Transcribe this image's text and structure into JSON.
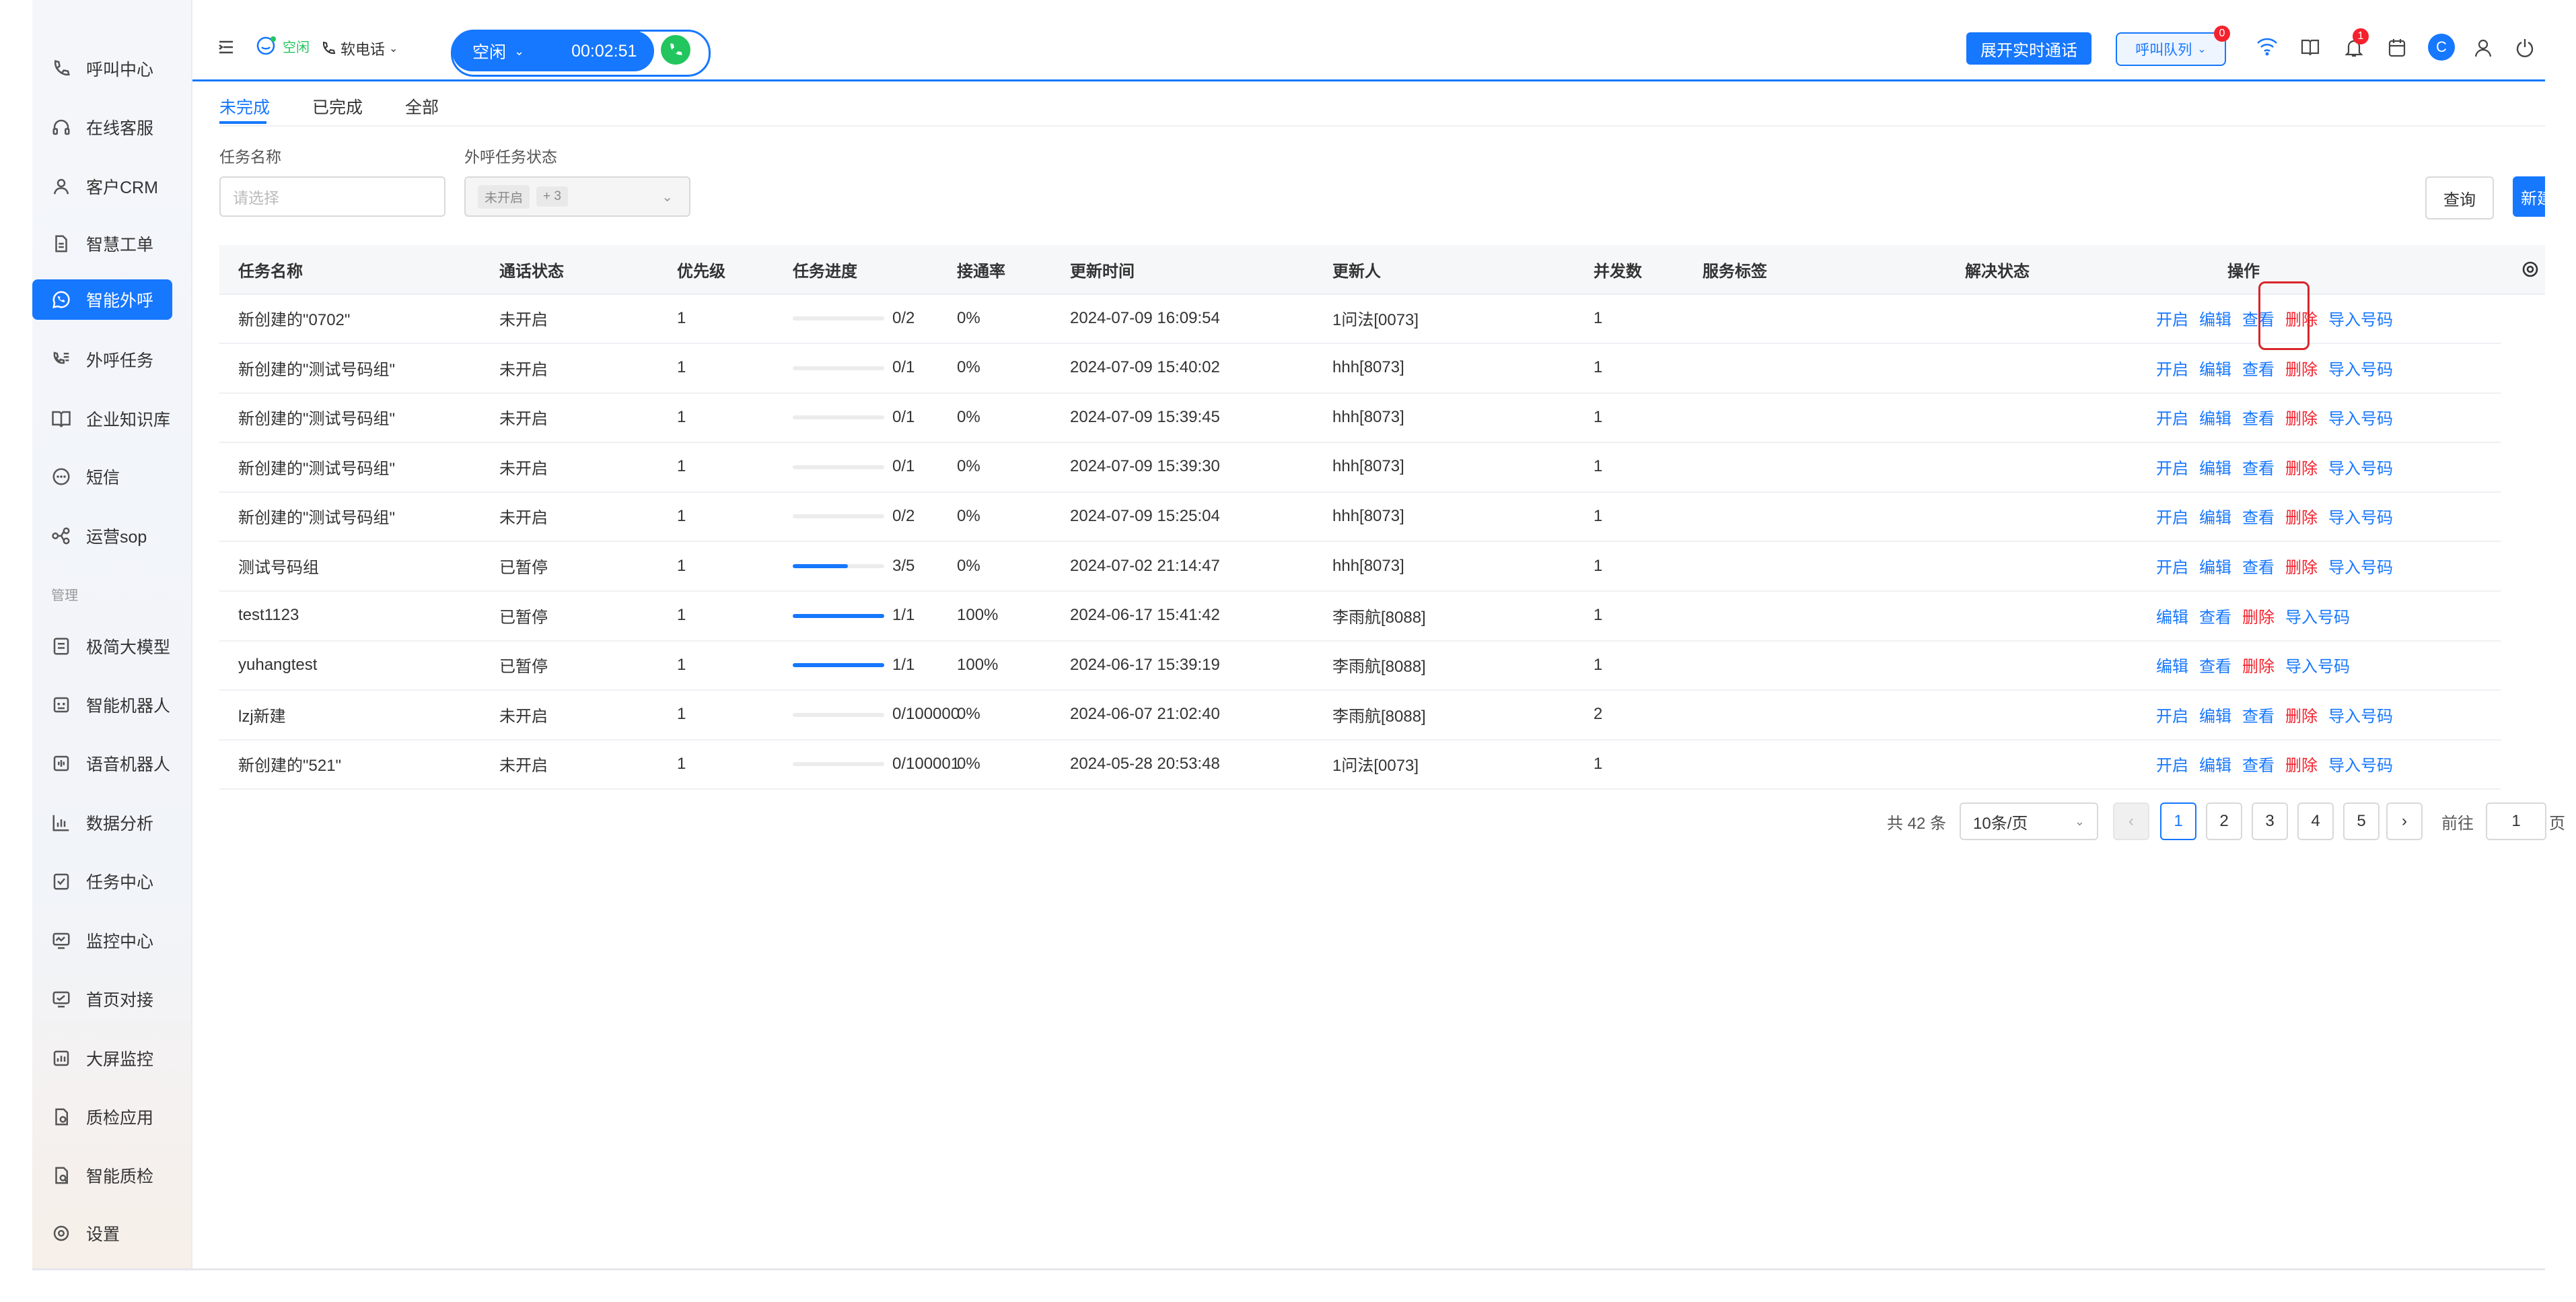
{
  "sidebar": {
    "items": [
      {
        "label": "呼叫中心",
        "icon": "phone-icon"
      },
      {
        "label": "在线客服",
        "icon": "headset-icon"
      },
      {
        "label": "客户CRM",
        "icon": "user-icon"
      },
      {
        "label": "智慧工单",
        "icon": "document-icon"
      },
      {
        "label": "智能外呼",
        "icon": "chat-phone-icon"
      },
      {
        "label": "外呼任务",
        "icon": "phone-list-icon"
      },
      {
        "label": "企业知识库",
        "icon": "book-icon"
      },
      {
        "label": "短信",
        "icon": "message-icon"
      },
      {
        "label": "运营sop",
        "icon": "flow-icon"
      }
    ],
    "section_label": "管理",
    "items2": [
      {
        "label": "极简大模型",
        "icon": "model-icon"
      },
      {
        "label": "智能机器人",
        "icon": "robot-icon"
      },
      {
        "label": "语音机器人",
        "icon": "voice-robot-icon"
      },
      {
        "label": "数据分析",
        "icon": "chart-icon"
      },
      {
        "label": "任务中心",
        "icon": "task-icon"
      },
      {
        "label": "监控中心",
        "icon": "monitor-icon"
      },
      {
        "label": "首页对接",
        "icon": "home-link-icon"
      },
      {
        "label": "大屏监控",
        "icon": "screen-icon"
      },
      {
        "label": "质检应用",
        "icon": "quality-icon"
      },
      {
        "label": "智能质检",
        "icon": "smart-quality-icon"
      },
      {
        "label": "设置",
        "icon": "settings-icon"
      }
    ]
  },
  "header": {
    "status_small": "空闲",
    "phone_mode": "软电话",
    "status": "空闲",
    "timer": "00:02:51",
    "expand_btn": "展开实时通话",
    "queue_btn": "呼叫队列",
    "queue_badge": "0",
    "bell_badge": "1",
    "avatar_letter": "C"
  },
  "tabs": [
    "未完成",
    "已完成",
    "全部"
  ],
  "filters": {
    "task_name_label": "任务名称",
    "task_name_placeholder": "请选择",
    "status_label": "外呼任务状态",
    "status_tag": "未开启",
    "status_more": "+ 3",
    "query_btn": "查询",
    "new_btn": "新建"
  },
  "table": {
    "headers": [
      "任务名称",
      "通话状态",
      "优先级",
      "任务进度",
      "接通率",
      "更新时间",
      "更新人",
      "并发数",
      "服务标签",
      "解决状态",
      "操作"
    ],
    "rows": [
      {
        "name": "新创建的\"0702\"",
        "call_status": "未开启",
        "priority": "1",
        "progress": "0/2",
        "progress_pct": 0,
        "rate": "0%",
        "time": "2024-07-09 16:09:54",
        "updater": "1问法[0073]",
        "concurrency": "1",
        "ops": [
          "开启",
          "编辑",
          "查看",
          "删除",
          "导入号码"
        ]
      },
      {
        "name": "新创建的\"测试号码组\"",
        "call_status": "未开启",
        "priority": "1",
        "progress": "0/1",
        "progress_pct": 0,
        "rate": "0%",
        "time": "2024-07-09 15:40:02",
        "updater": "hhh[8073]",
        "concurrency": "1",
        "ops": [
          "开启",
          "编辑",
          "查看",
          "删除",
          "导入号码"
        ]
      },
      {
        "name": "新创建的\"测试号码组\"",
        "call_status": "未开启",
        "priority": "1",
        "progress": "0/1",
        "progress_pct": 0,
        "rate": "0%",
        "time": "2024-07-09 15:39:45",
        "updater": "hhh[8073]",
        "concurrency": "1",
        "ops": [
          "开启",
          "编辑",
          "查看",
          "删除",
          "导入号码"
        ]
      },
      {
        "name": "新创建的\"测试号码组\"",
        "call_status": "未开启",
        "priority": "1",
        "progress": "0/1",
        "progress_pct": 0,
        "rate": "0%",
        "time": "2024-07-09 15:39:30",
        "updater": "hhh[8073]",
        "concurrency": "1",
        "ops": [
          "开启",
          "编辑",
          "查看",
          "删除",
          "导入号码"
        ]
      },
      {
        "name": "新创建的\"测试号码组\"",
        "call_status": "未开启",
        "priority": "1",
        "progress": "0/2",
        "progress_pct": 0,
        "rate": "0%",
        "time": "2024-07-09 15:25:04",
        "updater": "hhh[8073]",
        "concurrency": "1",
        "ops": [
          "开启",
          "编辑",
          "查看",
          "删除",
          "导入号码"
        ]
      },
      {
        "name": "测试号码组",
        "call_status": "已暂停",
        "priority": "1",
        "progress": "3/5",
        "progress_pct": 60,
        "rate": "0%",
        "time": "2024-07-02 21:14:47",
        "updater": "hhh[8073]",
        "concurrency": "1",
        "ops": [
          "开启",
          "编辑",
          "查看",
          "删除",
          "导入号码"
        ]
      },
      {
        "name": "test1123",
        "call_status": "已暂停",
        "priority": "1",
        "progress": "1/1",
        "progress_pct": 100,
        "rate": "100%",
        "time": "2024-06-17 15:41:42",
        "updater": "李雨航[8088]",
        "concurrency": "1",
        "ops": [
          "编辑",
          "查看",
          "删除",
          "导入号码"
        ]
      },
      {
        "name": "yuhangtest",
        "call_status": "已暂停",
        "priority": "1",
        "progress": "1/1",
        "progress_pct": 100,
        "rate": "100%",
        "time": "2024-06-17 15:39:19",
        "updater": "李雨航[8088]",
        "concurrency": "1",
        "ops": [
          "编辑",
          "查看",
          "删除",
          "导入号码"
        ]
      },
      {
        "name": "lzj新建",
        "call_status": "未开启",
        "priority": "1",
        "progress": "0/100000",
        "progress_pct": 0,
        "rate": "0%",
        "time": "2024-06-07 21:02:40",
        "updater": "李雨航[8088]",
        "concurrency": "2",
        "ops": [
          "开启",
          "编辑",
          "查看",
          "删除",
          "导入号码"
        ]
      },
      {
        "name": "新创建的\"521\"",
        "call_status": "未开启",
        "priority": "1",
        "progress": "0/100001",
        "progress_pct": 0,
        "rate": "0%",
        "time": "2024-05-28 20:53:48",
        "updater": "1问法[0073]",
        "concurrency": "1",
        "ops": [
          "开启",
          "编辑",
          "查看",
          "删除",
          "导入号码"
        ]
      }
    ]
  },
  "pagination": {
    "total": "共 42 条",
    "page_size": "10条/页",
    "pages": [
      "1",
      "2",
      "3",
      "4",
      "5"
    ],
    "current": "1",
    "goto_label": "前往",
    "goto_value": "1",
    "page_suffix": "页"
  },
  "colors": {
    "accent": "#1677ff",
    "danger": "#f5222d",
    "success": "#22c55e"
  }
}
